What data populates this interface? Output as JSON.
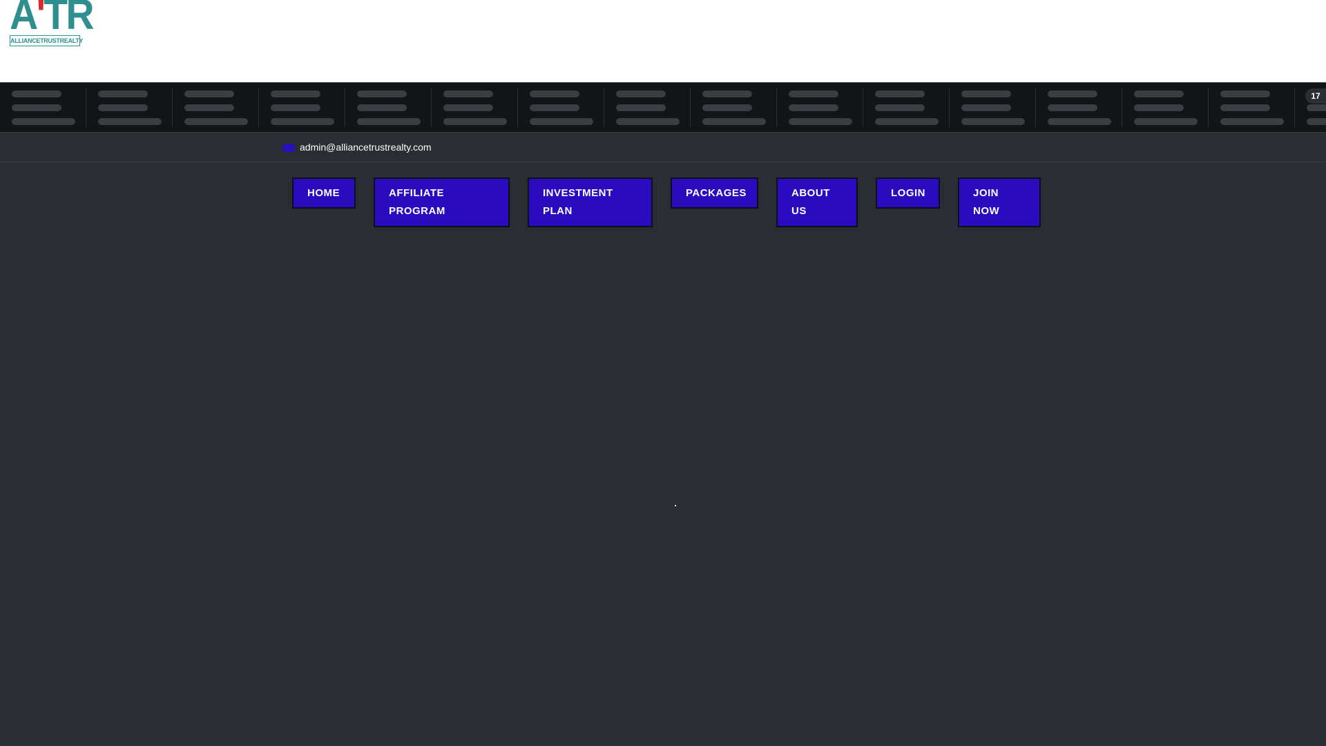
{
  "logo": {
    "letters_main": "A",
    "letters_accent": "'",
    "letters_rest": "TR",
    "tagline": "ALLIANCETRUSTREALTY"
  },
  "ticker": {
    "cells": 16,
    "logo_text": "17"
  },
  "contact": {
    "icon": "envelope-icon",
    "email": "admin@alliancetrustrealty.com"
  },
  "nav": {
    "home": "HOME",
    "affiliate": "AFFILIATE\nPROGRAM",
    "investment": "INVESTMENT\nPLAN",
    "packages": "PACKAGES",
    "about": "ABOUT\nUS",
    "login": "LOGIN",
    "join": "JOIN\nNOW"
  },
  "colors": {
    "background": "#2a2d31",
    "nav_button": "#2a0bbf",
    "logo_teal": "#2f8f8f",
    "logo_red": "#d62b2b"
  }
}
